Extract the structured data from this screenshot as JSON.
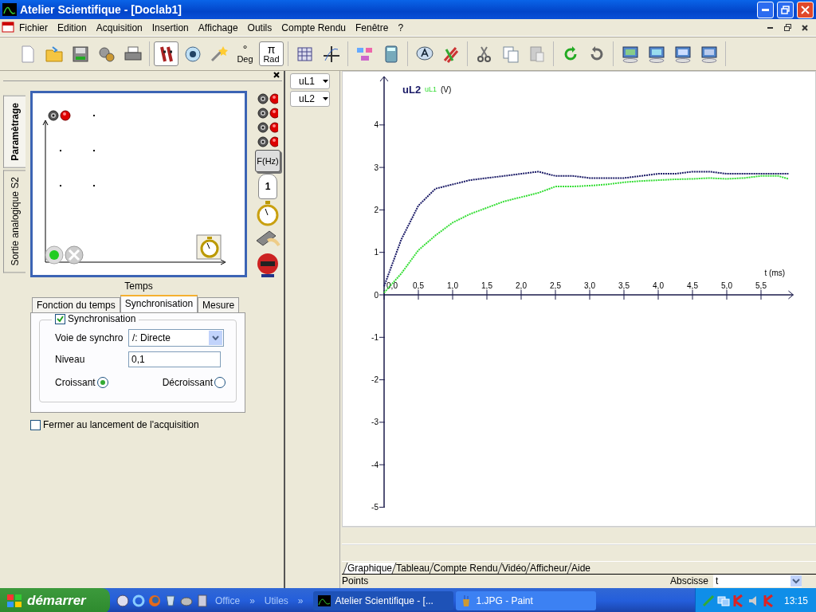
{
  "window": {
    "title": "Atelier Scientifique - [Doclab1]"
  },
  "menu": [
    "Fichier",
    "Edition",
    "Acquisition",
    "Insertion",
    "Affichage",
    "Outils",
    "Compte Rendu",
    "Fenêtre",
    "?"
  ],
  "toolbar": [
    [
      {
        "pressed": false
      },
      {
        "pressed": false
      },
      {
        "pressed": false
      },
      {
        "pressed": false
      },
      {
        "pressed": false
      }
    ],
    [
      {
        "pressed": true
      },
      {
        "pressed": false
      },
      {
        "pressed": false
      },
      {
        "symbol": "°",
        "label": "Deg",
        "pressed": false
      },
      {
        "symbol": "π",
        "label": "Rad",
        "pressed": true
      }
    ],
    [
      {
        "pressed": false
      },
      {
        "pressed": false
      }
    ],
    [
      {
        "pressed": false
      },
      {
        "pressed": false
      }
    ],
    [
      {
        "pressed": false
      },
      {
        "pressed": false
      }
    ],
    [
      {
        "pressed": false
      },
      {
        "pressed": false
      },
      {
        "pressed": false
      }
    ],
    [
      {
        "pressed": false
      },
      {
        "pressed": false
      }
    ],
    [
      {
        "pressed": false
      },
      {
        "pressed": false
      },
      {
        "pressed": false
      },
      {
        "pressed": false
      }
    ]
  ],
  "side_tabs": [
    {
      "label": "Paramètrage",
      "selected": true
    },
    {
      "label": "Sortie analogique S2",
      "selected": false
    }
  ],
  "tool_palette": {
    "frequency_label": "F(Hz)",
    "counter_label": "1"
  },
  "setup": {
    "axis_label": "Temps"
  },
  "settings_tabs": [
    {
      "label": "Fonction du temps",
      "selected": false
    },
    {
      "label": "Synchronisation",
      "selected": true
    },
    {
      "label": "Mesure",
      "selected": false
    }
  ],
  "sync": {
    "enabled": {
      "label": "Synchronisation",
      "checked": true
    },
    "channel": {
      "label": "Voie de synchro",
      "value": "/: Directe"
    },
    "level": {
      "label": "Niveau",
      "value": "0,1"
    },
    "edges": [
      {
        "label": "Croissant",
        "selected": true
      },
      {
        "label": "Décroissant",
        "selected": false
      }
    ]
  },
  "close_on_start": {
    "label": "Fermer au lancement de l'acquisition",
    "checked": false
  },
  "curve_selectors": [
    "uL1",
    "uL2"
  ],
  "graph": {
    "chart_data": {
      "type": "line",
      "xlabel": "t (ms)",
      "ylabel": "(V)",
      "xlim": [
        0,
        5.97
      ],
      "ylim": [
        -5,
        5.14
      ],
      "x": [
        0,
        0.25,
        0.5,
        0.75,
        1.0,
        1.25,
        1.5,
        1.75,
        2.0,
        2.25,
        2.5,
        2.75,
        3.0,
        3.25,
        3.5,
        3.75,
        4.0,
        4.25,
        4.5,
        4.75,
        5.0,
        5.25,
        5.5,
        5.75,
        5.9
      ],
      "series": [
        {
          "name": "uL2",
          "color": "#1a1a66",
          "line_style": "dotted",
          "values": [
            0.2,
            1.3,
            2.1,
            2.5,
            2.6,
            2.7,
            2.75,
            2.8,
            2.85,
            2.9,
            2.8,
            2.8,
            2.75,
            2.75,
            2.75,
            2.8,
            2.85,
            2.85,
            2.9,
            2.9,
            2.85,
            2.85,
            2.85,
            2.85,
            2.85
          ]
        },
        {
          "name": "uL1",
          "color": "#33dd33",
          "line_style": "dotted",
          "values": [
            0.05,
            0.5,
            1.05,
            1.4,
            1.7,
            1.9,
            2.05,
            2.2,
            2.3,
            2.4,
            2.55,
            2.55,
            2.57,
            2.6,
            2.65,
            2.68,
            2.7,
            2.72,
            2.73,
            2.75,
            2.73,
            2.75,
            2.8,
            2.8,
            2.73
          ]
        }
      ],
      "xticks": [
        {
          "value": 0,
          "label": "0,0"
        },
        {
          "value": 0.5,
          "label": "0,5"
        },
        {
          "value": 1,
          "label": "1,0"
        },
        {
          "value": 1.5,
          "label": "1,5"
        },
        {
          "value": 2,
          "label": "2,0"
        },
        {
          "value": 2.5,
          "label": "2,5"
        },
        {
          "value": 3,
          "label": "3,0"
        },
        {
          "value": 3.5,
          "label": "3,5"
        },
        {
          "value": 4,
          "label": "4,0"
        },
        {
          "value": 4.5,
          "label": "4,5"
        },
        {
          "value": 5,
          "label": "5,0"
        },
        {
          "value": 5.5,
          "label": "5,5"
        }
      ],
      "yticks": [
        4,
        3,
        2,
        1,
        0,
        -1,
        -2,
        -3,
        -4,
        -5
      ]
    }
  },
  "view_tabs": [
    {
      "label": "Graphique",
      "selected": true
    },
    {
      "label": "Tableau",
      "selected": false
    },
    {
      "label": "Compte Rendu",
      "selected": false
    },
    {
      "label": "Vidéo",
      "selected": false
    },
    {
      "label": "Afficheur",
      "selected": false
    },
    {
      "label": "Aide",
      "selected": false
    }
  ],
  "status_bar": {
    "points": "Points",
    "abscissa_label": "Abscisse",
    "abscissa_value": "t"
  },
  "taskbar": {
    "start": "démarrer",
    "toolbars": [
      "Office",
      "»",
      "Utiles",
      "»"
    ],
    "tasks": [
      {
        "label": "Atelier Scientifique - [...",
        "selected": true
      },
      {
        "label": "1.JPG - Paint",
        "selected": false
      }
    ],
    "clock": "13:15"
  }
}
